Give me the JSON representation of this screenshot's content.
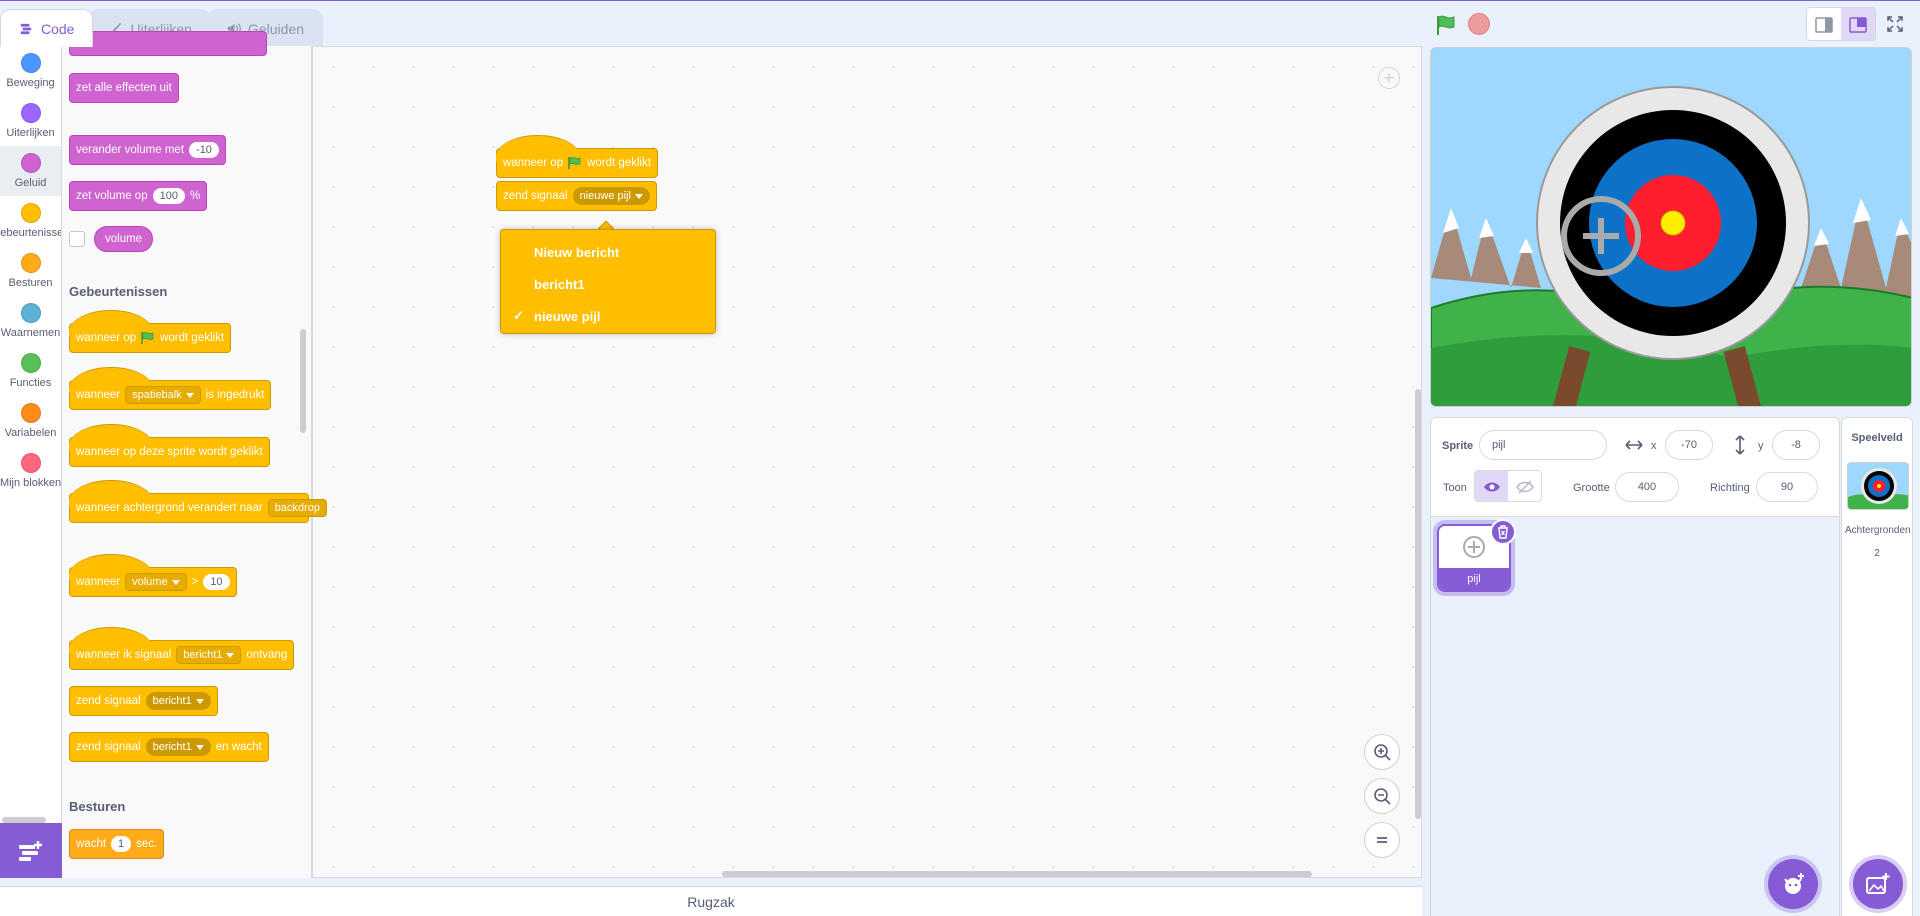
{
  "tabs": [
    {
      "label": "Code"
    },
    {
      "label": "Uiterlijken"
    },
    {
      "label": "Geluiden"
    }
  ],
  "categories": [
    {
      "label": "Beweging",
      "color": "#4c97ff"
    },
    {
      "label": "Uiterlijken",
      "color": "#9966ff"
    },
    {
      "label": "Geluid",
      "color": "#cf63cf"
    },
    {
      "label": "Gebeurtenissen",
      "color": "#ffbf00"
    },
    {
      "label": "Besturen",
      "color": "#ffab19"
    },
    {
      "label": "Waarnemen",
      "color": "#5cb1d6"
    },
    {
      "label": "Functies",
      "color": "#59c059"
    },
    {
      "label": "Variabelen",
      "color": "#ff8c1a"
    },
    {
      "label": "Mijn blokken",
      "color": "#ff6680"
    }
  ],
  "palette": {
    "sound": {
      "clear_effects": "zet alle effecten uit",
      "change_volume": "verander volume met",
      "change_volume_value": "-10",
      "set_volume": "zet volume op",
      "set_volume_value": "100",
      "set_volume_unit": "%",
      "volume_reporter": "volume"
    },
    "events_title": "Gebeurtenissen",
    "events": {
      "flag_a": "wanneer op",
      "flag_b": "wordt geklikt",
      "key_a": "wanneer",
      "key_value": "spatiebalk",
      "key_b": "is ingedrukt",
      "sprite_clicked": "wanneer op deze sprite wordt geklikt",
      "backdrop_a": "wanneer achtergrond verandert naar",
      "backdrop_value": "backdrop",
      "gt_a": "wanneer",
      "gt_value": "volume",
      "gt_op": ">",
      "gt_num": "10",
      "receive_a": "wanneer ik signaal",
      "receive_value": "bericht1",
      "receive_b": "ontvang",
      "broadcast": "zend signaal",
      "broadcast_value": "bericht1",
      "broadcast_wait": "zend signaal",
      "broadcast_wait_value": "bericht1",
      "broadcast_wait_b": "en wacht"
    },
    "control_title": "Besturen",
    "control": {
      "wait": "wacht",
      "wait_value": "1",
      "wait_unit": "sec."
    }
  },
  "script": {
    "hat_a": "wanneer op",
    "hat_b": "wordt geklikt",
    "broadcast": "zend signaal",
    "broadcast_value": "nieuwe pijl"
  },
  "dropdown": {
    "items": [
      {
        "label": "Nieuw bericht",
        "checked": false
      },
      {
        "label": "bericht1",
        "checked": false
      },
      {
        "label": "nieuwe pijl",
        "checked": true
      }
    ],
    "check_glyph": "✓"
  },
  "backpack": "Rugzak",
  "sprite_info": {
    "sprite_label": "Sprite",
    "sprite_name": "pijl",
    "x_label": "x",
    "x_value": "-70",
    "y_label": "y",
    "y_value": "-8",
    "show_label": "Toon",
    "size_label": "Grootte",
    "size_value": "400",
    "direction_label": "Richting",
    "direction_value": "90"
  },
  "sprites": [
    {
      "name": "pijl",
      "selected": true
    }
  ],
  "stage_pane": {
    "title": "Speelveld",
    "backdrops_label": "Achtergronden",
    "backdrops_count": "2"
  },
  "colors": {
    "accent": "#855cd6",
    "events": "#ffbf00",
    "sound": "#cf63cf",
    "control": "#ffab19",
    "flag": "#4cbf56",
    "stop": "#ec5959"
  }
}
